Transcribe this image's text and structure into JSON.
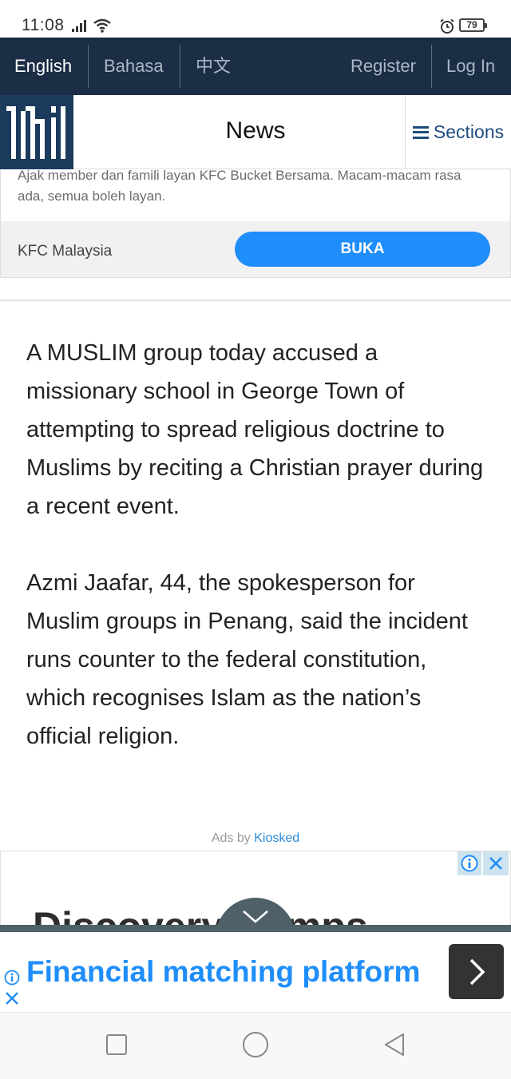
{
  "status_bar": {
    "time": "11:08",
    "battery": "79",
    "icons": [
      "signal-icon",
      "wifi-icon",
      "alarm-icon",
      "battery-icon"
    ]
  },
  "top_nav": {
    "languages": [
      "English",
      "Bahasa",
      "中文"
    ],
    "active_language": "English",
    "register": "Register",
    "login": "Log In"
  },
  "header": {
    "title": "News",
    "sections_label": "Sections",
    "logo_name": "tmi-logo"
  },
  "ad_top": {
    "description": "Ajak member dan famili layan KFC Bucket Bersama. Macam-macam rasa ada, semua boleh layan.",
    "brand": "KFC Malaysia",
    "cta": "BUKA",
    "cta_color": "#1f8efa"
  },
  "article": {
    "paragraphs": [
      "A MUSLIM group today accused a missionary school in George Town of attempting to spread religious doctrine to Muslims by reciting a Christian prayer during a recent event.",
      "Azmi Jaafar, 44, the spokesperson for Muslim groups in Penang, said the incident runs counter to the federal constitution, which recognises Islam as the nation’s official religion."
    ]
  },
  "ads_by": {
    "prefix": "Ads by ",
    "provider": "Kiosked"
  },
  "ad_box": {
    "title": "Discovery Camps"
  },
  "bottom_banner": {
    "text": "Financial matching platform",
    "color": "#1f8efa"
  },
  "colors": {
    "nav_bg": "#1b2e45",
    "logo_bg": "#1b3a5c",
    "link_blue": "#1d4d7e"
  }
}
